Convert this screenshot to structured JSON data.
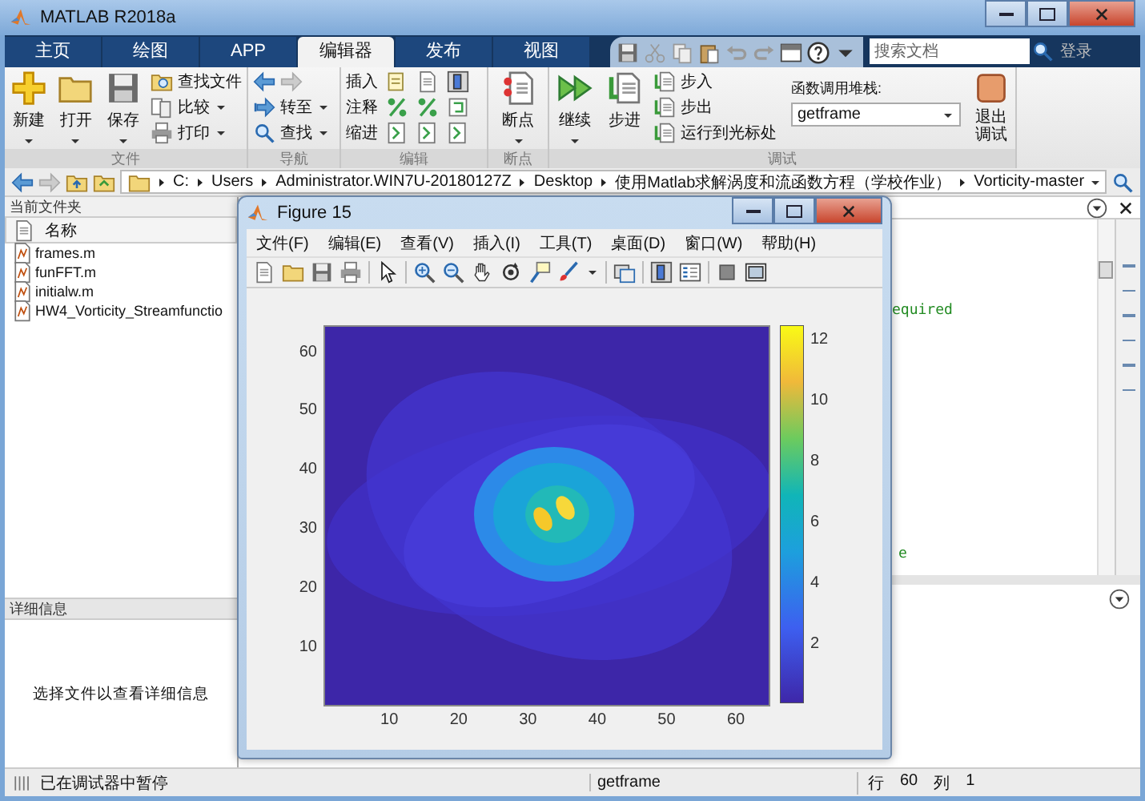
{
  "window": {
    "title": "MATLAB R2018a"
  },
  "tabs": [
    {
      "label": "主页",
      "selected": false
    },
    {
      "label": "绘图",
      "selected": false
    },
    {
      "label": "APP",
      "selected": false
    },
    {
      "label": "编辑器",
      "selected": true
    },
    {
      "label": "发布",
      "selected": false
    },
    {
      "label": "视图",
      "selected": false
    }
  ],
  "search": {
    "placeholder": "搜索文档"
  },
  "login": "登录",
  "toolstrip": {
    "file": {
      "label": "文件",
      "large": [
        "新建",
        "打开",
        "保存"
      ],
      "small": [
        "查找文件",
        "比较",
        "打印"
      ]
    },
    "navigate": {
      "label": "导航",
      "small": [
        "转至",
        "查找"
      ]
    },
    "edit": {
      "label": "编辑",
      "small": [
        "插入",
        "注释",
        "缩进"
      ]
    },
    "breakpoints": {
      "label": "断点",
      "large": [
        "断点"
      ]
    },
    "debug": {
      "label": "调试",
      "large": [
        "继续",
        "步进"
      ],
      "small": [
        "步入",
        "步出",
        "运行到光标处"
      ],
      "stack_label": "函数调用堆栈:",
      "stack_value": "getframe",
      "quit": "退出调试"
    }
  },
  "address": [
    "C:",
    "Users",
    "Administrator.WIN7U-20180127Z",
    "Desktop",
    "使用Matlab求解涡度和流函数方程（学校作业）",
    "Vorticity-master"
  ],
  "current_folder": {
    "title": "当前文件夹",
    "column": "名称",
    "files": [
      "frames.m",
      "funFFT.m",
      "initialw.m",
      "HW4_Vorticity_Streamfunctio"
    ]
  },
  "details": {
    "title": "详细信息",
    "message": "选择文件以查看详细信息"
  },
  "editor": {
    "code_fragments": [
      "equired",
      "e"
    ]
  },
  "figure": {
    "title": "Figure 15",
    "menu": [
      "文件(F)",
      "编辑(E)",
      "查看(V)",
      "插入(I)",
      "工具(T)",
      "桌面(D)",
      "窗口(W)",
      "帮助(H)"
    ],
    "x_ticks": [
      "10",
      "20",
      "30",
      "40",
      "50",
      "60"
    ],
    "y_ticks": [
      "60",
      "50",
      "40",
      "30",
      "20",
      "10"
    ],
    "colorbar_ticks": [
      "12",
      "10",
      "8",
      "6",
      "4",
      "2"
    ]
  },
  "status_bar": {
    "message": "已在调试器中暂停",
    "function": "getframe",
    "line_label": "行",
    "line": "60",
    "col_label": "列",
    "col": "1"
  }
}
